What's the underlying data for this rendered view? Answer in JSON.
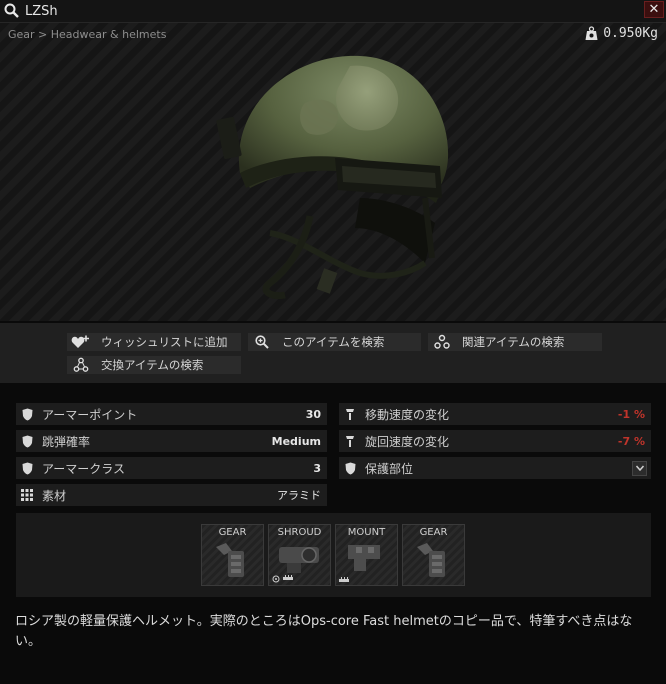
{
  "window": {
    "title": "LZSh",
    "close_label": "✕"
  },
  "breadcrumb": "Gear > Headwear & helmets",
  "weight": "0.950Kg",
  "actions": [
    {
      "label": "ウィッシュリストに追加",
      "icon": "heart-plus-icon"
    },
    {
      "label": "このアイテムを検索",
      "icon": "search-icon"
    },
    {
      "label": "関連アイテムの検索",
      "icon": "related-icon"
    },
    {
      "label": "交換アイテムの検索",
      "icon": "barter-icon"
    }
  ],
  "stats_left": [
    {
      "label": "アーマーポイント",
      "value": "30",
      "icon": "shield-icon"
    },
    {
      "label": "跳弾確率",
      "value": "Medium",
      "icon": "shield-icon"
    },
    {
      "label": "アーマークラス",
      "value": "3",
      "icon": "shield-icon"
    },
    {
      "label": "素材",
      "value": "アラミド",
      "icon": "grid-icon"
    }
  ],
  "stats_right": [
    {
      "label": "移動速度の変化",
      "value": "-1 %",
      "icon": "speed-icon"
    },
    {
      "label": "旋回速度の変化",
      "value": "-7 %",
      "icon": "turn-icon"
    },
    {
      "label": "保護部位",
      "value": "",
      "icon": "shield-icon"
    }
  ],
  "slots": [
    "GEAR",
    "SHROUD",
    "MOUNT",
    "GEAR"
  ],
  "description": "ロシア製の軽量保護ヘルメット。実際のところはOps-core Fast helmetのコピー品で、特筆すべき点はない。",
  "colors": {
    "negative": "#c0342b",
    "close_bg": "#3b0f0f"
  }
}
